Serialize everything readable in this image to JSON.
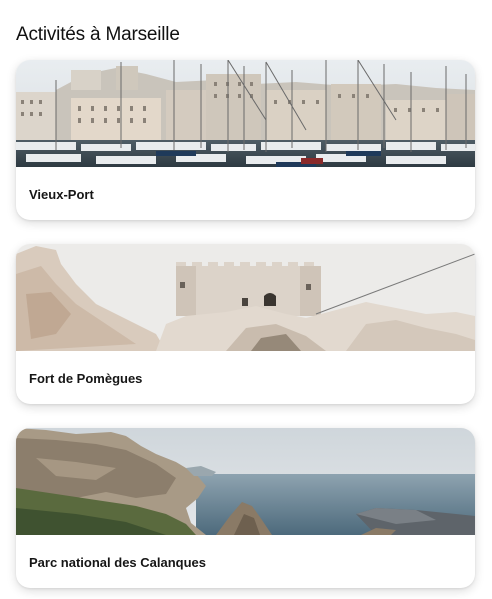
{
  "page": {
    "title": "Activités à Marseille"
  },
  "activities": [
    {
      "name": "Vieux-Port",
      "image": "marseille-old-port-harbor-photo"
    },
    {
      "name": "Fort de Pomègues",
      "image": "fort-on-rocky-island-photo"
    },
    {
      "name": "Parc national des Calanques",
      "image": "calanques-cliffs-sea-photo"
    }
  ]
}
